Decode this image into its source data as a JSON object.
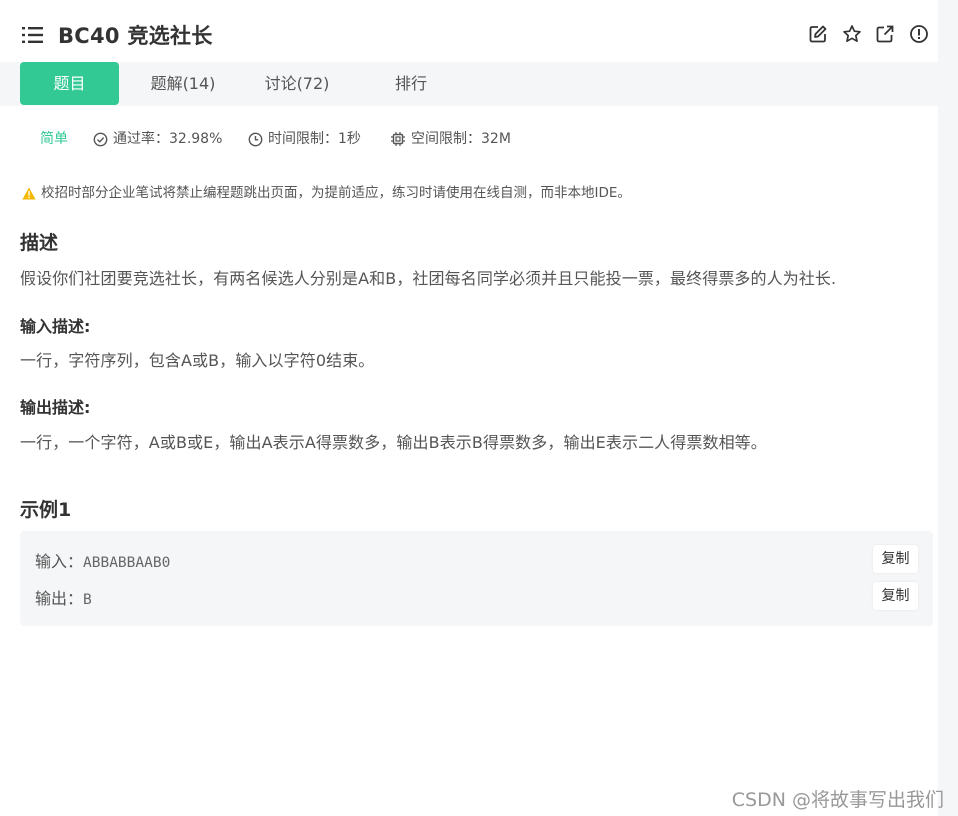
{
  "header": {
    "title": "BC40  竞选社长",
    "icons": [
      "edit-icon",
      "star-icon",
      "external-link-icon",
      "info-icon"
    ]
  },
  "tabs": [
    {
      "label": "题目",
      "active": true
    },
    {
      "label": "题解(14)",
      "active": false
    },
    {
      "label": "讨论(72)",
      "active": false
    },
    {
      "label": "排行",
      "active": false
    }
  ],
  "meta": {
    "difficulty": "简单",
    "pass_rate": "通过率：32.98%",
    "time_limit": "时间限制：1秒",
    "space_limit": "空间限制：32M"
  },
  "notice": "校招时部分企业笔试将禁止编程题跳出页面，为提前适应，练习时请使用在线自测，而非本地IDE。",
  "description": {
    "heading": "描述",
    "text": "假设你们社团要竞选社长，有两名候选人分别是A和B，社团每名同学必须并且只能投一票，最终得票多的人为社长."
  },
  "input_desc": {
    "heading": "输入描述:",
    "text": "一行，字符序列，包含A或B，输入以字符0结束。"
  },
  "output_desc": {
    "heading": "输出描述:",
    "text": "一行，一个字符，A或B或E，输出A表示A得票数多，输出B表示B得票数多，输出E表示二人得票数相等。"
  },
  "example": {
    "heading": "示例1",
    "input_label": "输入：",
    "input_value": "ABBABBAAB0",
    "output_label": "输出：",
    "output_value": "B",
    "copy_label": "复制"
  },
  "watermark": "CSDN @将故事写出我们",
  "colors": {
    "accent": "#32c995",
    "warning": "#f5b800",
    "tab_bar_bg": "#f5f6f8"
  }
}
